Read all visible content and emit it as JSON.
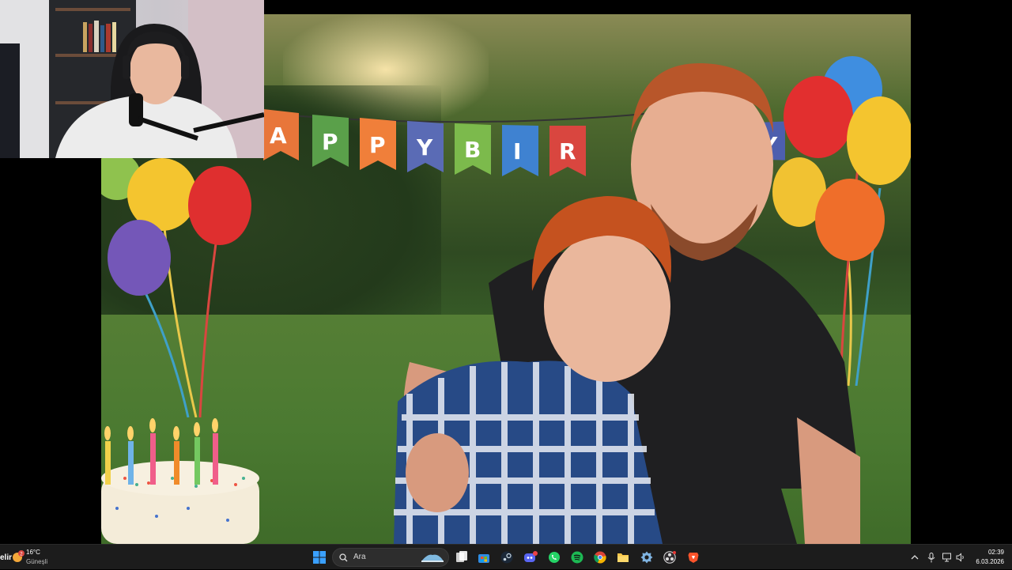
{
  "viewer": {
    "banner_letters": [
      "A",
      "P",
      "P",
      "Y",
      "B",
      "I",
      "R",
      "Y"
    ]
  },
  "taskbar": {
    "weather": {
      "cut_text": "elir",
      "temperature": "16°C",
      "condition": "Güneşli",
      "badge": "2"
    },
    "search_placeholder": "Ara",
    "apps": [
      "windows-start",
      "search",
      "widgets-app",
      "task-view",
      "microsoft-store",
      "steam",
      "discord",
      "whatsapp",
      "spotify",
      "chrome",
      "file-explorer",
      "settings-app",
      "obs",
      "brave"
    ],
    "clock": {
      "time": "02:39",
      "date": "6.03.2026"
    }
  },
  "colors": {
    "taskbar_bg": "#1c1c1c",
    "accent_blue": "#3b82f6",
    "spotify_green": "#1db954"
  }
}
